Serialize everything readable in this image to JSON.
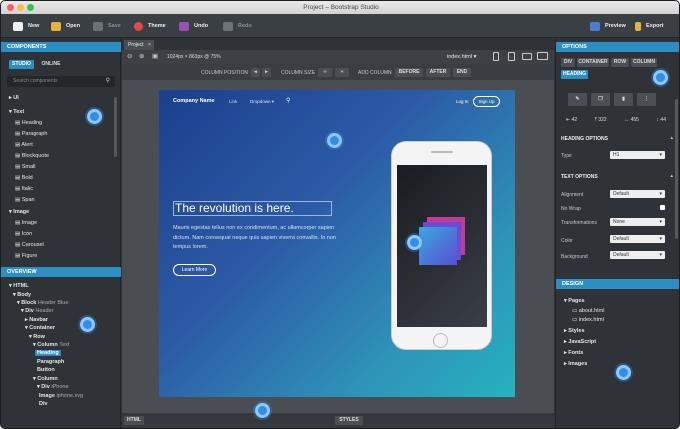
{
  "window": {
    "title": "Project – Bootstrap Studio"
  },
  "toolbar": {
    "new": "New",
    "open": "Open",
    "save": "Save",
    "theme": "Theme",
    "undo": "Undo",
    "redo": "Redo",
    "preview": "Preview",
    "export": "Export"
  },
  "components": {
    "header": "COMPONENTS",
    "tabs": [
      "STUDIO",
      "ONLINE"
    ],
    "search_placeholder": "Search components",
    "groups": [
      {
        "label": "UI",
        "items": []
      },
      {
        "label": "Text",
        "items": [
          "Heading",
          "Paragraph",
          "Alert",
          "Blockquote",
          "Small",
          "Bold",
          "Italic",
          "Span"
        ]
      },
      {
        "label": "Image",
        "items": [
          "Image",
          "Icon",
          "Carousel",
          "Figure"
        ]
      }
    ]
  },
  "overview": {
    "header": "OVERVIEW",
    "nodes": [
      {
        "label": "HTML",
        "sub": ""
      },
      {
        "label": "Body",
        "sub": ""
      },
      {
        "label": "Block",
        "sub": "Header Blue"
      },
      {
        "label": "Div",
        "sub": "Header"
      },
      {
        "label": "Navbar",
        "sub": ""
      },
      {
        "label": "Container",
        "sub": ""
      },
      {
        "label": "Row",
        "sub": ""
      },
      {
        "label": "Column",
        "sub": "Text"
      },
      {
        "label": "Heading",
        "sub": ""
      },
      {
        "label": "Paragraph",
        "sub": ""
      },
      {
        "label": "Button",
        "sub": ""
      },
      {
        "label": "Column",
        "sub": ""
      },
      {
        "label": "Div",
        "sub": "iPhone"
      },
      {
        "label": "Image",
        "sub": "iphone.svg"
      },
      {
        "label": "Div",
        "sub": ""
      }
    ]
  },
  "editor": {
    "tab": "Project",
    "tab_close": "×",
    "viewport": "1024px × 863px @ 75%",
    "file": "index.html",
    "column_position": "COLUMN POSITION",
    "column_size": "COLUMN SIZE",
    "add_column": "ADD COLUMN",
    "before": "BEFORE",
    "after": "AFTER",
    "end": "END",
    "bottom_html": "HTML",
    "bottom_styles": "STYLES"
  },
  "page": {
    "brand": "Company Name",
    "nav_link": "Link",
    "nav_dropdown": "Dropdown",
    "login": "Log In",
    "signup": "Sign Up",
    "heading": "The revolution is here.",
    "paragraph": "Mauris egestas tellus non ex condimentum, ac ullamcorper sapien dictum. Nam consequat neque quis sapien viverra convallis. In non tempus lorem.",
    "button": "Learn More"
  },
  "options": {
    "header": "OPTIONS",
    "element_tabs": [
      "DIV",
      "CONTAINER",
      "ROW",
      "COLUMN"
    ],
    "active": "HEADING",
    "coords": [
      "42",
      "322",
      "455",
      "44"
    ],
    "heading_options": "HEADING OPTIONS",
    "type_label": "Type",
    "type_value": "H1",
    "text_options": "TEXT OPTIONS",
    "rows": [
      {
        "label": "Alignment",
        "value": "Default"
      },
      {
        "label": "No Wrap",
        "value": ""
      },
      {
        "label": "Transformations",
        "value": "None"
      },
      {
        "label": "Color",
        "value": "Default"
      },
      {
        "label": "Background",
        "value": "Default"
      }
    ]
  },
  "design": {
    "header": "DESIGN",
    "pages": "Pages",
    "files": [
      "about.html",
      "index.html"
    ],
    "items": [
      "Styles",
      "JavaScript",
      "Fonts",
      "Images"
    ]
  }
}
